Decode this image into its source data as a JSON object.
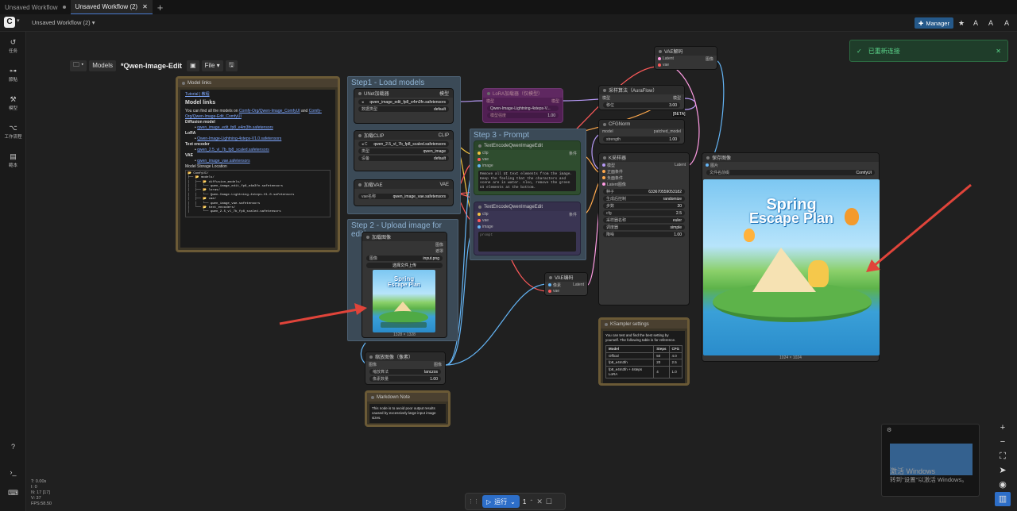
{
  "tabs": [
    {
      "label": "Unsaved Workflow"
    },
    {
      "label": "Unsaved Workflow (2)"
    }
  ],
  "topbar": {
    "workflow_name": "Unsaved Workflow (2)",
    "manager_label": "Manager"
  },
  "sidebar": {
    "items": [
      {
        "icon": "history-icon",
        "label": "任务"
      },
      {
        "icon": "nodes-icon",
        "label": "節點"
      },
      {
        "icon": "models-icon",
        "label": "模型"
      },
      {
        "icon": "workflows-icon",
        "label": "工作流程"
      },
      {
        "icon": "templates-icon",
        "label": "範本"
      }
    ]
  },
  "canvas_toolbar": {
    "models_label": "Models",
    "title": "*Qwen-Image-Edit",
    "file_label": "File"
  },
  "groups": {
    "g1": "Step1 - Load models",
    "g2": "Step 2 - Upload image for editing",
    "g3": "Step 3 - Prompt"
  },
  "model_links": {
    "title": "Model links",
    "tutorial": "Tutorial | 教程",
    "heading": "Model links",
    "intro_prefix": "You can find all the models on",
    "link1": "Comfy-Org/Qwen-Image_ComfyUI",
    "intro_and": "and",
    "link2": "Comfy-Org/Qwen-Image-Edit_ComfyUI",
    "diffusion": "Diffusion model",
    "diffusion_file": "qwen_image_edit_fp8_e4m3fn.safetensors",
    "lora": "LoRA",
    "lora_file": "Qwen-Image-Lightning-4steps-V1.0.safetensors",
    "te": "Text encoder",
    "te_file": "qwen_2.5_vl_7b_fp8_scaled.safetensors",
    "vae": "VAE",
    "vae_file": "qwen_image_vae.safetensors",
    "storage": "Model Storage Location",
    "tree": [
      "📂 ComfyUI/",
      "├── 📂 models/",
      "│   ├── 📂 diffusion_models/",
      "│   │   └── qwen_image_edit_fp8_e4m3fn.safetensors",
      "│   ├── 📂 loras/",
      "│   │   └── Qwen-Image-Lightning-4steps-V1.0.safetensors",
      "│   ├── 📂 vae/",
      "│   │   └── qwen_image_vae.safetensors",
      "│   └── 📂 text_encoders/",
      "│       └── qwen_2.5_vl_7b_fp8_scaled.safetensors"
    ]
  },
  "unet": {
    "title": "UNet加载器",
    "name": "qwen_image_edit_fp8_e4m3fn.safetensors",
    "dtype_label": "数据类型",
    "dtype": "default",
    "out": "模型"
  },
  "clip": {
    "title": "加载CLIP",
    "name": "qwen_2.5_vl_7b_fp8_scaled.safetensors",
    "type_label": "类型",
    "type": "qwen_image",
    "device_label": "设备",
    "device": "default",
    "out": "CLIP"
  },
  "vaeload": {
    "title": "加载VAE",
    "label": "vae名称",
    "name": "qwen_image_vae.safetensors",
    "out": "VAE"
  },
  "lora": {
    "title": "LoRA加载器（仅模型）",
    "name": "Qwen-Image-Lightning-4steps-V...",
    "strength_label": "模型强度",
    "strength": "1.00",
    "in": "模型",
    "out": "模型"
  },
  "loadimg": {
    "title": "加载图像",
    "out1": "图像",
    "out2": "遮罩",
    "img_label": "图像",
    "img": "input.png",
    "upload": "选择文件上传",
    "dims": "1328 × 1328"
  },
  "scale": {
    "title": "缩放图像（像素）",
    "in": "图像",
    "out": "图像",
    "method_label": "缩放算法",
    "method": "lanczos",
    "mp_label": "像素数量",
    "mp": "1.00"
  },
  "note": {
    "title": "Markdown Note",
    "text": "This node is to avoid poor output results caused by excessively large input image sizes."
  },
  "te1": {
    "title": "TextEncodeQwenImageEdit",
    "in": [
      "clip",
      "vae",
      "image"
    ],
    "out": "条件",
    "prompt": "Remove all UI text elements from the image. Keep the feeling that the characters and scene are in water. Also, remove the green UI elements at the bottom."
  },
  "te2": {
    "title": "TextEncodeQwenImageEdit",
    "in": [
      "clip",
      "vae",
      "image"
    ],
    "out": "条件",
    "prompt": "prompt"
  },
  "vaeenc": {
    "title": "VAE编码",
    "in1": "像素",
    "in2": "vae",
    "out": "Latent"
  },
  "vaedec": {
    "title": "VAE解码",
    "in1": "Latent",
    "in2": "vae",
    "out": "图像"
  },
  "aura": {
    "title": "采样算法（AuraFlow）",
    "in": "模型",
    "out": "模型",
    "shift_label": "移位",
    "shift": "3.00"
  },
  "cfgnorm": {
    "title": "CFGNorm",
    "in": "model",
    "out": "patched_model",
    "str_label": "strength",
    "str": "1.00",
    "badge": "[BETA]"
  },
  "ksampler": {
    "title": "K采样器",
    "in": [
      "模型",
      "正面条件",
      "负面条件",
      "Latent图像"
    ],
    "out": "Latent",
    "rows": [
      [
        "种子",
        "633670559053182"
      ],
      [
        "生成后控制",
        "randomize"
      ],
      [
        "步数",
        "20"
      ],
      [
        "cfg",
        "2.5"
      ],
      [
        "采样器名称",
        "euler"
      ],
      [
        "调度器",
        "simple"
      ],
      [
        "降噪",
        "1.00"
      ]
    ]
  },
  "ksettings": {
    "title": "KSampler settings",
    "desc": "You can test and find the best setting by yourself. The following table is for reference.",
    "headers": [
      "Model",
      "Steps",
      "CFG"
    ],
    "rows": [
      [
        "Offical",
        "50",
        "4.0"
      ],
      [
        "fp8_e4m3fn",
        "20",
        "2.5"
      ],
      [
        "fp8_e4m3fn + 4steps LoRA",
        "4",
        "1.0"
      ]
    ]
  },
  "save": {
    "title": "保存图像",
    "in": "图片",
    "prefix_label": "文件名前缀",
    "prefix": "ComfyUI",
    "dims": "1024 × 1024"
  },
  "image": {
    "title_line1": "Spring",
    "title_line2": "Escape Plan"
  },
  "toast": {
    "text": "已重新连接"
  },
  "run": {
    "label": "运行",
    "count": "1"
  },
  "stats": [
    "T: 0.00s",
    "I: 0",
    "N: 17 [17]",
    "V: 37",
    "FPS:58.50"
  ],
  "watermark": {
    "line1": "激活 Windows",
    "line2": "转到\"设置\"以激活 Windows。"
  }
}
